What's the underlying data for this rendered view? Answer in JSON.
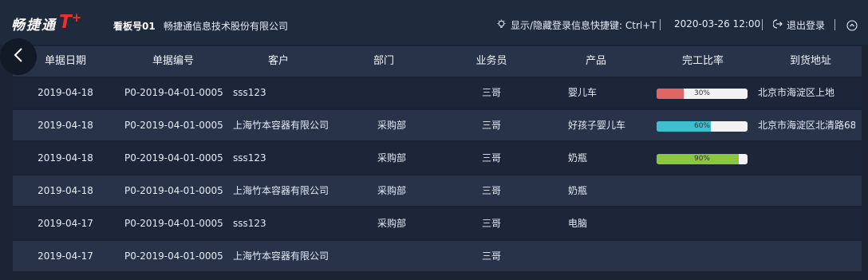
{
  "topbar": {
    "logo_text": "畅捷通",
    "logo_brand": "T",
    "logo_plus": "+",
    "board_label": "看板号01",
    "company": "畅捷通信息技术股份有限公司",
    "hint": "显示/隐藏登录信息快捷键: Ctrl+T",
    "datetime": "2020-03-26 12:00",
    "logout": "退出登录"
  },
  "table": {
    "headers": [
      "单据日期",
      "单据编号",
      "客户",
      "部门",
      "业务员",
      "产品",
      "完工比率",
      "到货地址"
    ],
    "rows": [
      {
        "date": "2019-04-18",
        "no": "P0-2019-04-01-0005",
        "customer": "sss123",
        "dept": "",
        "salesman": "三哥",
        "product": "婴儿车",
        "progress": 30,
        "progress_label": "30%",
        "progress_color": "#e06666",
        "address": "北京市海淀区上地"
      },
      {
        "date": "2019-04-18",
        "no": "P0-2019-04-01-0005",
        "customer": "上海竹本容器有限公司",
        "dept": "采购部",
        "salesman": "三哥",
        "product": "好孩子婴儿车",
        "progress": 60,
        "progress_label": "60%",
        "progress_color": "#3ebfcf",
        "address": "北京市海淀区北清路68..."
      },
      {
        "date": "2019-04-18",
        "no": "P0-2019-04-01-0005",
        "customer": "sss123",
        "dept": "采购部",
        "salesman": "三哥",
        "product": "奶瓶",
        "progress": 90,
        "progress_label": "90%",
        "progress_color": "#8cc63e",
        "address": ""
      },
      {
        "date": "2019-04-18",
        "no": "P0-2019-04-01-0005",
        "customer": "上海竹本容器有限公司",
        "dept": "采购部",
        "salesman": "三哥",
        "product": "奶瓶",
        "progress": null,
        "progress_label": "",
        "progress_color": "",
        "address": ""
      },
      {
        "date": "2019-04-17",
        "no": "P0-2019-04-01-0005",
        "customer": "sss123",
        "dept": "采购部",
        "salesman": "三哥",
        "product": "电脑",
        "progress": null,
        "progress_label": "",
        "progress_color": "",
        "address": ""
      },
      {
        "date": "2019-04-17",
        "no": "P0-2019-04-01-0005",
        "customer": "上海竹本容器有限公司",
        "dept": "",
        "salesman": "三哥",
        "product": "",
        "progress": null,
        "progress_label": "",
        "progress_color": "",
        "address": ""
      }
    ]
  },
  "icons": {
    "back": "chevron-left-icon",
    "hint": "lightbulb-icon",
    "logout": "logout-icon",
    "collapse": "chevron-up-circle-icon"
  }
}
